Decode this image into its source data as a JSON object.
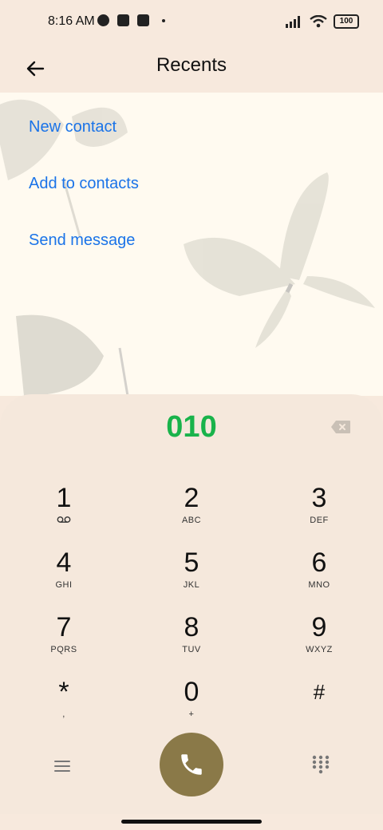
{
  "status_bar": {
    "time": "8:16 AM",
    "battery": "100"
  },
  "header": {
    "title": "Recents"
  },
  "actions": {
    "new_contact": "New contact",
    "add_to_contacts": "Add to contacts",
    "send_message": "Send message"
  },
  "dialpad": {
    "number": "010",
    "keys": [
      {
        "digit": "1",
        "letters": ""
      },
      {
        "digit": "2",
        "letters": "ABC"
      },
      {
        "digit": "3",
        "letters": "DEF"
      },
      {
        "digit": "4",
        "letters": "GHI"
      },
      {
        "digit": "5",
        "letters": "JKL"
      },
      {
        "digit": "6",
        "letters": "MNO"
      },
      {
        "digit": "7",
        "letters": "PQRS"
      },
      {
        "digit": "8",
        "letters": "TUV"
      },
      {
        "digit": "9",
        "letters": "WXYZ"
      },
      {
        "digit": "*",
        "letters": ","
      },
      {
        "digit": "0",
        "letters": "+"
      },
      {
        "digit": "#",
        "letters": ""
      }
    ]
  },
  "colors": {
    "number_green": "#19b34b",
    "link_blue": "#1a73e8",
    "call_button": "#8a7948"
  }
}
